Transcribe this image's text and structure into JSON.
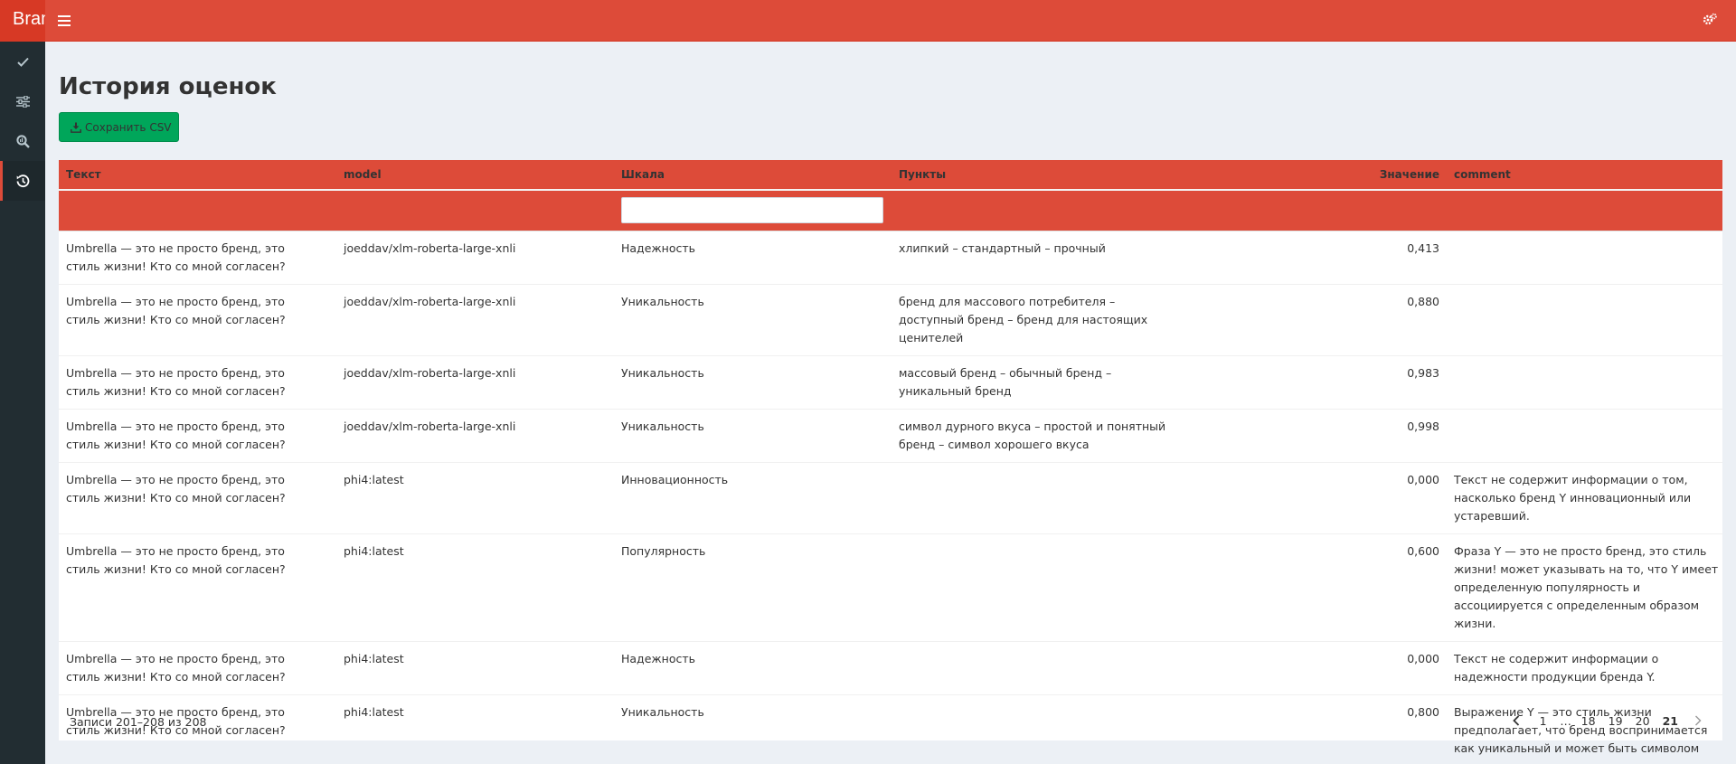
{
  "app": {
    "brand": "Brand"
  },
  "page": {
    "title": "История оценок"
  },
  "toolbar": {
    "save_csv_label": "Сохранить CSV"
  },
  "sidebar": {
    "items": [
      {
        "icon": "check-icon"
      },
      {
        "icon": "sliders-icon"
      },
      {
        "icon": "search-chart-icon"
      },
      {
        "icon": "history-icon",
        "active": true
      }
    ]
  },
  "table": {
    "columns": [
      "Текст",
      "model",
      "Шкала",
      "Пункты",
      "Значение",
      "comment"
    ],
    "rows": [
      {
        "text": "Umbrella — это не просто бренд, это стиль жизни! Кто со мной согласен?",
        "model": "joeddav/xlm-roberta-large-xnli",
        "scale": "Надежность",
        "points": "хлипкий – стандартный – прочный",
        "value": "0,413",
        "comment": ""
      },
      {
        "text": "Umbrella — это не просто бренд, это стиль жизни! Кто со мной согласен?",
        "model": "joeddav/xlm-roberta-large-xnli",
        "scale": "Уникальность",
        "points": "бренд для массового потребителя – доступный бренд – бренд для настоящих ценителей",
        "value": "0,880",
        "comment": ""
      },
      {
        "text": "Umbrella — это не просто бренд, это стиль жизни! Кто со мной согласен?",
        "model": "joeddav/xlm-roberta-large-xnli",
        "scale": "Уникальность",
        "points": "массовый бренд – обычный бренд – уникальный бренд",
        "value": "0,983",
        "comment": ""
      },
      {
        "text": "Umbrella — это не просто бренд, это стиль жизни! Кто со мной согласен?",
        "model": "joeddav/xlm-roberta-large-xnli",
        "scale": "Уникальность",
        "points": "символ дурного вкуса – простой и понятный бренд – символ хорошего вкуса",
        "value": "0,998",
        "comment": ""
      },
      {
        "text": "Umbrella — это не просто бренд, это стиль жизни! Кто со мной согласен?",
        "model": "phi4:latest",
        "scale": "Инновационность",
        "points": "",
        "value": "0,000",
        "comment": "Текст не содержит информации о том, насколько бренд Y инновационный или устаревший."
      },
      {
        "text": "Umbrella — это не просто бренд, это стиль жизни! Кто со мной согласен?",
        "model": "phi4:latest",
        "scale": "Популярность",
        "points": "",
        "value": "0,600",
        "comment": "Фраза Y — это не просто бренд, это стиль жизни! может указывать на то, что Y имеет определенную популярность и ассоциируется с определенным образом жизни."
      },
      {
        "text": "Umbrella — это не просто бренд, это стиль жизни! Кто со мной согласен?",
        "model": "phi4:latest",
        "scale": "Надежность",
        "points": "",
        "value": "0,000",
        "comment": "Текст не содержит информации о надежности продукции бренда Y."
      },
      {
        "text": "Umbrella — это не просто бренд, это стиль жизни! Кто со мной согласен?",
        "model": "phi4:latest",
        "scale": "Уникальность",
        "points": "",
        "value": "0,800",
        "comment": "Выражение Y — это стиль жизни предполагает, что бренд воспринимается как уникальный и может быть символом изысканного вкуса."
      }
    ]
  },
  "footer": {
    "info": "Записи 201–208 из 208",
    "pages": [
      "1",
      "…",
      "18",
      "19",
      "20",
      "21"
    ],
    "current_page": "21"
  },
  "colors": {
    "header_red": "#dd4b39",
    "sidebar_dark": "#222d32",
    "button_green": "#00a65a",
    "background": "#ecf0f5"
  }
}
